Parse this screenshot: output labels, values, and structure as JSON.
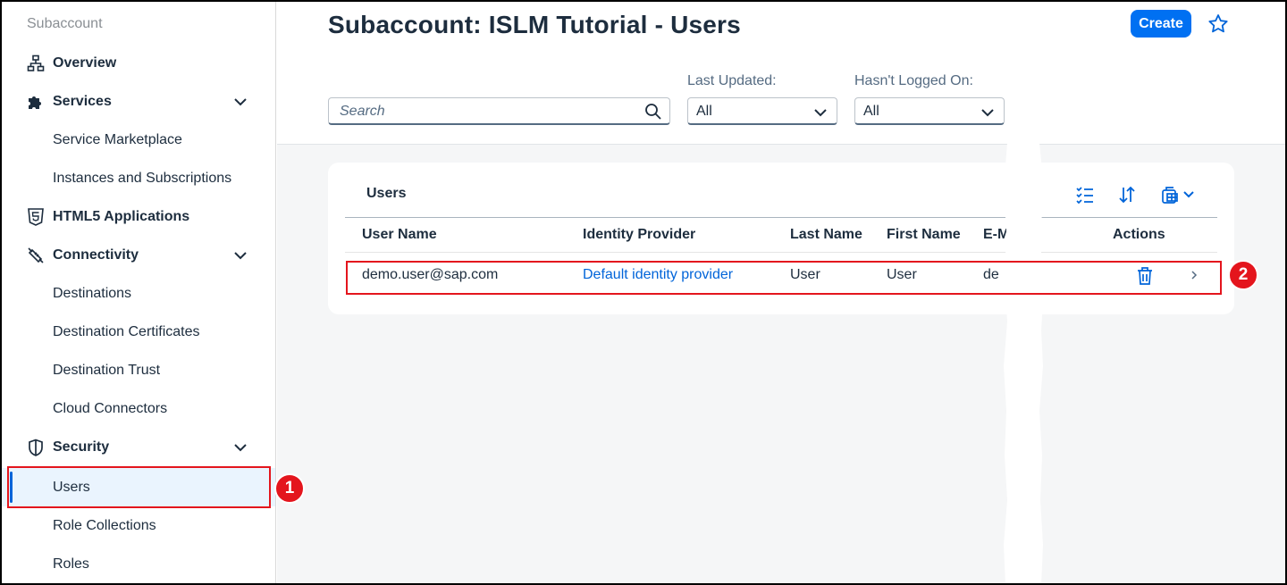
{
  "sidebar": {
    "header": "Subaccount",
    "items": [
      {
        "label": "Overview",
        "icon": "hierarchy-icon"
      },
      {
        "label": "Services",
        "icon": "puzzle-icon"
      },
      {
        "label": "Service Marketplace"
      },
      {
        "label": "Instances and Subscriptions"
      },
      {
        "label": "HTML5 Applications",
        "icon": "html5-icon"
      },
      {
        "label": "Connectivity",
        "icon": "connectivity-icon"
      },
      {
        "label": "Destinations"
      },
      {
        "label": "Destination Certificates"
      },
      {
        "label": "Destination Trust"
      },
      {
        "label": "Cloud Connectors"
      },
      {
        "label": "Security",
        "icon": "shield-icon"
      },
      {
        "label": "Users",
        "selected": true
      },
      {
        "label": "Role Collections"
      },
      {
        "label": "Roles"
      }
    ]
  },
  "header": {
    "title": "Subaccount: ISLM Tutorial - Users",
    "create_label": "Create"
  },
  "filters": {
    "search_placeholder": "Search",
    "last_updated_label": "Last Updated:",
    "last_updated_value": "All",
    "not_logged_label": "Hasn't Logged On:",
    "not_logged_value": "All"
  },
  "table": {
    "title": "Users",
    "columns": [
      "User Name",
      "Identity Provider",
      "Last Name",
      "First Name",
      "E-M",
      "Actions"
    ],
    "rows": [
      {
        "user_name": "demo.user@sap.com",
        "identity_provider": "Default identity provider",
        "last_name": "User",
        "first_name": "User",
        "email": "de"
      }
    ]
  },
  "annotations": {
    "badge1": "1",
    "badge2": "2"
  },
  "colors": {
    "accent": "#0070f2",
    "link": "#0064d9",
    "highlight": "#e4151d",
    "selected_bg": "#eaf4fe"
  }
}
